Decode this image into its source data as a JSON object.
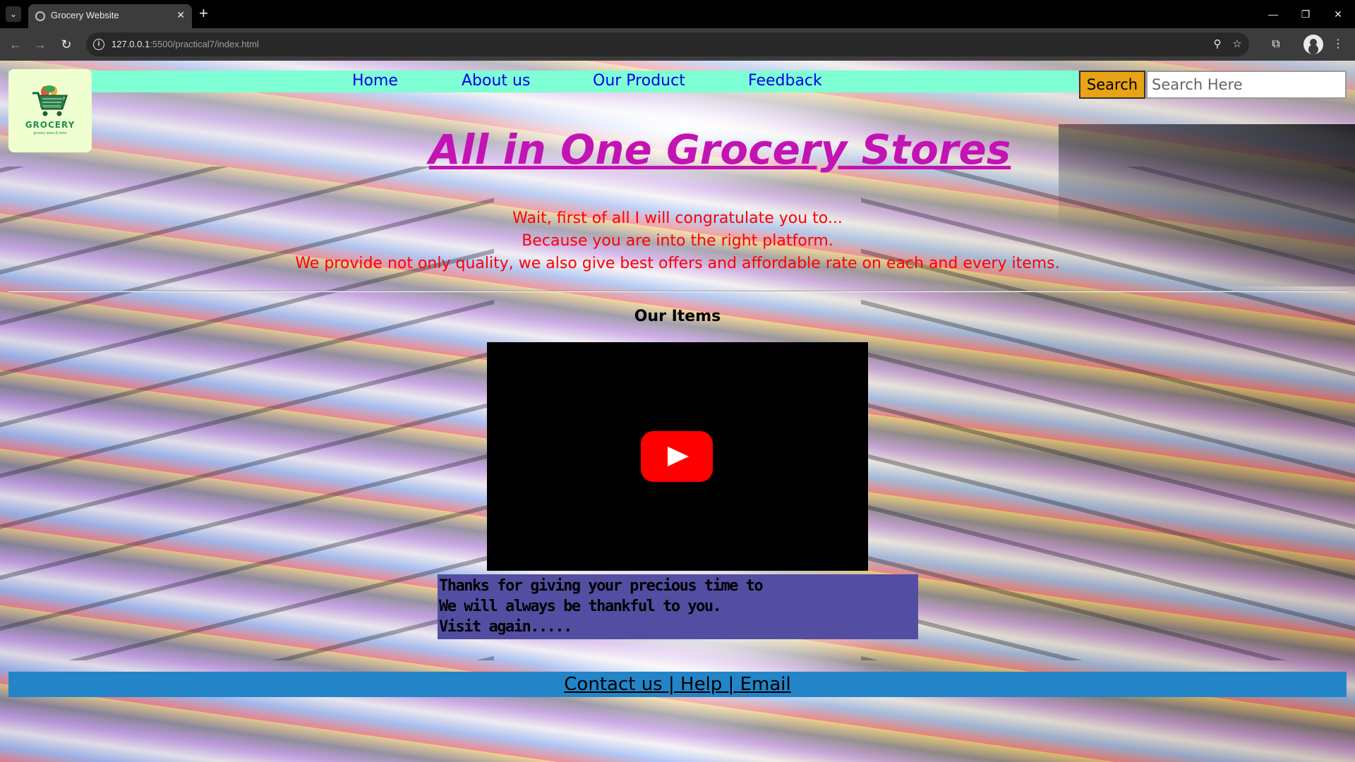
{
  "browser": {
    "tab_title": "Grocery Website",
    "url_host": "127.0.0.1",
    "url_path": ":5500/practical7/index.html"
  },
  "nav": {
    "links": [
      "Home",
      "About us",
      "Our Product",
      "Feedback"
    ]
  },
  "logo": {
    "text": "GROCERY",
    "tagline": "grocery store & more"
  },
  "search": {
    "button_label": "Search",
    "placeholder": "Search Here"
  },
  "heading": "All in One Grocery Stores",
  "intro": {
    "lines": [
      "Wait, first of all I will congratulate you to...",
      "Because you are into the right platform.",
      "We provide not only quality, we also give best offers and affordable rate on each and every items."
    ]
  },
  "items": {
    "title": "Our Items"
  },
  "thanks": {
    "lines": [
      "Thanks for giving your precious time to",
      "We will always be thankful to you.",
      "Visit again....."
    ]
  },
  "footer": {
    "text": "Contact us | Help | Email"
  },
  "colors": {
    "navbar_bg": "#7fffd4",
    "heading": "#c313b3",
    "intro_text": "#ff0000",
    "search_button": "#e8a317",
    "thanks_bg": "#534ea1",
    "footer_bg": "#2385c8",
    "link": "#0000ee"
  }
}
